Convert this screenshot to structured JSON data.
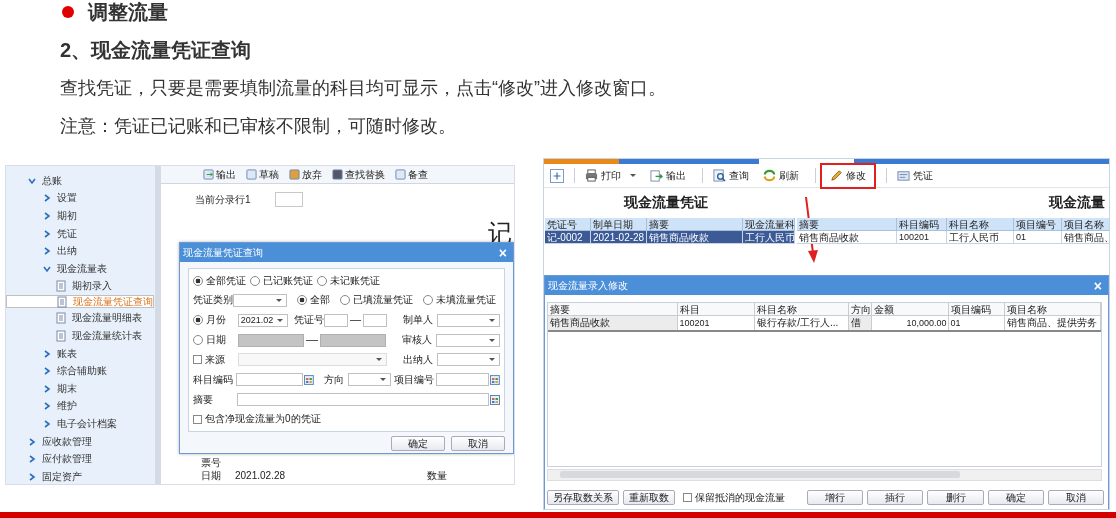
{
  "heading": "调整流量",
  "subheading": "2、现金流量凭证查询",
  "paragraphs": [
    "查找凭证，只要是需要填制流量的科目均可显示，点击“修改”进入修改窗口。",
    "注意：凭证已记账和已审核不限制，可随时修改。"
  ],
  "left_screenshot": {
    "sidebar": {
      "items": [
        {
          "label": "总账",
          "kind": "folder",
          "expanded": true,
          "selected": false,
          "children": [
            {
              "label": "设置",
              "kind": "folder",
              "expanded": false,
              "selected": false
            },
            {
              "label": "期初",
              "kind": "folder",
              "expanded": false,
              "selected": false
            },
            {
              "label": "凭证",
              "kind": "folder",
              "expanded": false,
              "selected": false
            },
            {
              "label": "出纳",
              "kind": "folder",
              "expanded": false,
              "selected": false
            },
            {
              "label": "现金流量表",
              "kind": "folder",
              "expanded": true,
              "selected": false,
              "children": [
                {
                  "label": "期初录入",
                  "kind": "doc",
                  "selected": false
                },
                {
                  "label": "现金流量凭证查询",
                  "kind": "doc",
                  "selected": true
                },
                {
                  "label": "现金流量明细表",
                  "kind": "doc",
                  "selected": false
                },
                {
                  "label": "现金流量统计表",
                  "kind": "doc",
                  "selected": false
                }
              ]
            },
            {
              "label": "账表",
              "kind": "folder",
              "expanded": false,
              "selected": false
            },
            {
              "label": "综合辅助账",
              "kind": "folder",
              "expanded": false,
              "selected": false
            },
            {
              "label": "期末",
              "kind": "folder",
              "expanded": false,
              "selected": false
            },
            {
              "label": "维护",
              "kind": "folder",
              "expanded": false,
              "selected": false
            },
            {
              "label": "电子会计档案",
              "kind": "folder",
              "expanded": false,
              "selected": false
            }
          ]
        },
        {
          "label": "应收款管理",
          "kind": "folder",
          "expanded": false,
          "selected": false
        },
        {
          "label": "应付款管理",
          "kind": "folder",
          "expanded": false,
          "selected": false
        },
        {
          "label": "固定资产",
          "kind": "folder",
          "expanded": false,
          "selected": false
        }
      ]
    },
    "toolbar": [
      {
        "label": "输出",
        "kind": "export"
      },
      {
        "label": "草稿",
        "kind": "draft"
      },
      {
        "label": "放弃",
        "kind": "discard"
      },
      {
        "label": "查找替换",
        "kind": "find"
      },
      {
        "label": "备查",
        "kind": "check"
      }
    ],
    "current_row_label": "当前分录行1",
    "voucher_title": "记",
    "footer": {
      "ticket_label": "票号",
      "date_label": "日期",
      "date": "2021.02.28",
      "quantity_label": "数量"
    },
    "dialog": {
      "title": "现金流量凭证查询",
      "close": "×",
      "posting_filter": [
        {
          "label": "全部凭证",
          "selected": true
        },
        {
          "label": "已记账凭证",
          "selected": false
        },
        {
          "label": "未记账凭证",
          "selected": false
        }
      ],
      "voucher_type_label": "凭证类别",
      "flow_filter": [
        {
          "label": "全部",
          "selected": true
        },
        {
          "label": "已填流量凭证",
          "selected": false
        },
        {
          "label": "未填流量凭证",
          "selected": false
        }
      ],
      "period_mode": [
        {
          "label": "月份",
          "selected": true
        },
        {
          "label": "日期",
          "selected": false
        }
      ],
      "month": "2021.02",
      "voucher_no_label": "凭证号",
      "source": {
        "label": "来源",
        "checked": false
      },
      "people": [
        "制单人",
        "审核人",
        "出纳人"
      ],
      "account_code_label": "科目编码",
      "direction_label": "方向",
      "project_code_label": "项目编号",
      "summary_label": "摘要",
      "include_zero": {
        "label": "包含净现金流量为0的凭证",
        "checked": false
      },
      "buttons": [
        "确定",
        "取消"
      ]
    }
  },
  "right_screenshot": {
    "toolbar": [
      {
        "label": "打印",
        "kind": "print",
        "dropdown": true,
        "highlighted": false
      },
      {
        "label": "输出",
        "kind": "export",
        "dropdown": false,
        "highlighted": false
      },
      {
        "label": "查询",
        "kind": "query",
        "dropdown": false,
        "highlighted": false
      },
      {
        "label": "刷新",
        "kind": "refresh",
        "dropdown": false,
        "highlighted": false
      },
      {
        "label": "修改",
        "kind": "edit",
        "dropdown": false,
        "highlighted": true
      },
      {
        "label": "凭证",
        "kind": "voucher",
        "dropdown": false,
        "highlighted": false
      }
    ],
    "title": "现金流量凭证",
    "title_right": "现金流量",
    "voucher_table": {
      "columns": [
        "凭证号",
        "制单日期",
        "摘要",
        "现金流量科"
      ],
      "rows": [
        {
          "cells": [
            "记-0002",
            "2021-02-28",
            "销售商品收款",
            "工行人民币"
          ],
          "selected": true
        }
      ]
    },
    "detail_table": {
      "columns": [
        "摘要",
        "科目编码",
        "科目名称",
        "项目编号",
        "项目名称"
      ],
      "rows": [
        {
          "cells": [
            "销售商品收款",
            "100201",
            "工行人民币",
            "01",
            "销售商品、"
          ],
          "selected": false
        }
      ]
    },
    "dialog": {
      "title": "现金流量录入修改",
      "close": "×",
      "columns": [
        "摘要",
        "科目",
        "科目名称",
        "方向",
        "金额",
        "项目编码",
        "项目名称"
      ],
      "rows": [
        {
          "cells": [
            "销售商品收款",
            "100201",
            "银行存款/工行人...",
            "借",
            "10,000.00",
            "01",
            "销售商品、提供劳务"
          ]
        }
      ],
      "left_buttons": [
        "另存取数关系",
        "重新取数"
      ],
      "keep_offset": {
        "label": "保留抵消的现金流量",
        "checked": false
      },
      "right_buttons": [
        "增行",
        "插行",
        "删行",
        "确定",
        "取消"
      ]
    }
  }
}
